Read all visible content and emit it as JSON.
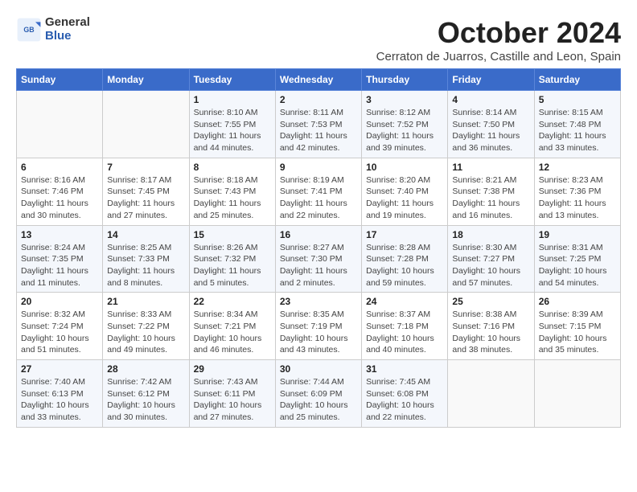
{
  "header": {
    "logo": {
      "line1": "General",
      "line2": "Blue"
    },
    "title": "October 2024",
    "subtitle": "Cerraton de Juarros, Castille and Leon, Spain"
  },
  "weekdays": [
    "Sunday",
    "Monday",
    "Tuesday",
    "Wednesday",
    "Thursday",
    "Friday",
    "Saturday"
  ],
  "weeks": [
    [
      {
        "day": "",
        "info": ""
      },
      {
        "day": "",
        "info": ""
      },
      {
        "day": "1",
        "info": "Sunrise: 8:10 AM\nSunset: 7:55 PM\nDaylight: 11 hours and 44 minutes."
      },
      {
        "day": "2",
        "info": "Sunrise: 8:11 AM\nSunset: 7:53 PM\nDaylight: 11 hours and 42 minutes."
      },
      {
        "day": "3",
        "info": "Sunrise: 8:12 AM\nSunset: 7:52 PM\nDaylight: 11 hours and 39 minutes."
      },
      {
        "day": "4",
        "info": "Sunrise: 8:14 AM\nSunset: 7:50 PM\nDaylight: 11 hours and 36 minutes."
      },
      {
        "day": "5",
        "info": "Sunrise: 8:15 AM\nSunset: 7:48 PM\nDaylight: 11 hours and 33 minutes."
      }
    ],
    [
      {
        "day": "6",
        "info": "Sunrise: 8:16 AM\nSunset: 7:46 PM\nDaylight: 11 hours and 30 minutes."
      },
      {
        "day": "7",
        "info": "Sunrise: 8:17 AM\nSunset: 7:45 PM\nDaylight: 11 hours and 27 minutes."
      },
      {
        "day": "8",
        "info": "Sunrise: 8:18 AM\nSunset: 7:43 PM\nDaylight: 11 hours and 25 minutes."
      },
      {
        "day": "9",
        "info": "Sunrise: 8:19 AM\nSunset: 7:41 PM\nDaylight: 11 hours and 22 minutes."
      },
      {
        "day": "10",
        "info": "Sunrise: 8:20 AM\nSunset: 7:40 PM\nDaylight: 11 hours and 19 minutes."
      },
      {
        "day": "11",
        "info": "Sunrise: 8:21 AM\nSunset: 7:38 PM\nDaylight: 11 hours and 16 minutes."
      },
      {
        "day": "12",
        "info": "Sunrise: 8:23 AM\nSunset: 7:36 PM\nDaylight: 11 hours and 13 minutes."
      }
    ],
    [
      {
        "day": "13",
        "info": "Sunrise: 8:24 AM\nSunset: 7:35 PM\nDaylight: 11 hours and 11 minutes."
      },
      {
        "day": "14",
        "info": "Sunrise: 8:25 AM\nSunset: 7:33 PM\nDaylight: 11 hours and 8 minutes."
      },
      {
        "day": "15",
        "info": "Sunrise: 8:26 AM\nSunset: 7:32 PM\nDaylight: 11 hours and 5 minutes."
      },
      {
        "day": "16",
        "info": "Sunrise: 8:27 AM\nSunset: 7:30 PM\nDaylight: 11 hours and 2 minutes."
      },
      {
        "day": "17",
        "info": "Sunrise: 8:28 AM\nSunset: 7:28 PM\nDaylight: 10 hours and 59 minutes."
      },
      {
        "day": "18",
        "info": "Sunrise: 8:30 AM\nSunset: 7:27 PM\nDaylight: 10 hours and 57 minutes."
      },
      {
        "day": "19",
        "info": "Sunrise: 8:31 AM\nSunset: 7:25 PM\nDaylight: 10 hours and 54 minutes."
      }
    ],
    [
      {
        "day": "20",
        "info": "Sunrise: 8:32 AM\nSunset: 7:24 PM\nDaylight: 10 hours and 51 minutes."
      },
      {
        "day": "21",
        "info": "Sunrise: 8:33 AM\nSunset: 7:22 PM\nDaylight: 10 hours and 49 minutes."
      },
      {
        "day": "22",
        "info": "Sunrise: 8:34 AM\nSunset: 7:21 PM\nDaylight: 10 hours and 46 minutes."
      },
      {
        "day": "23",
        "info": "Sunrise: 8:35 AM\nSunset: 7:19 PM\nDaylight: 10 hours and 43 minutes."
      },
      {
        "day": "24",
        "info": "Sunrise: 8:37 AM\nSunset: 7:18 PM\nDaylight: 10 hours and 40 minutes."
      },
      {
        "day": "25",
        "info": "Sunrise: 8:38 AM\nSunset: 7:16 PM\nDaylight: 10 hours and 38 minutes."
      },
      {
        "day": "26",
        "info": "Sunrise: 8:39 AM\nSunset: 7:15 PM\nDaylight: 10 hours and 35 minutes."
      }
    ],
    [
      {
        "day": "27",
        "info": "Sunrise: 7:40 AM\nSunset: 6:13 PM\nDaylight: 10 hours and 33 minutes."
      },
      {
        "day": "28",
        "info": "Sunrise: 7:42 AM\nSunset: 6:12 PM\nDaylight: 10 hours and 30 minutes."
      },
      {
        "day": "29",
        "info": "Sunrise: 7:43 AM\nSunset: 6:11 PM\nDaylight: 10 hours and 27 minutes."
      },
      {
        "day": "30",
        "info": "Sunrise: 7:44 AM\nSunset: 6:09 PM\nDaylight: 10 hours and 25 minutes."
      },
      {
        "day": "31",
        "info": "Sunrise: 7:45 AM\nSunset: 6:08 PM\nDaylight: 10 hours and 22 minutes."
      },
      {
        "day": "",
        "info": ""
      },
      {
        "day": "",
        "info": ""
      }
    ]
  ]
}
